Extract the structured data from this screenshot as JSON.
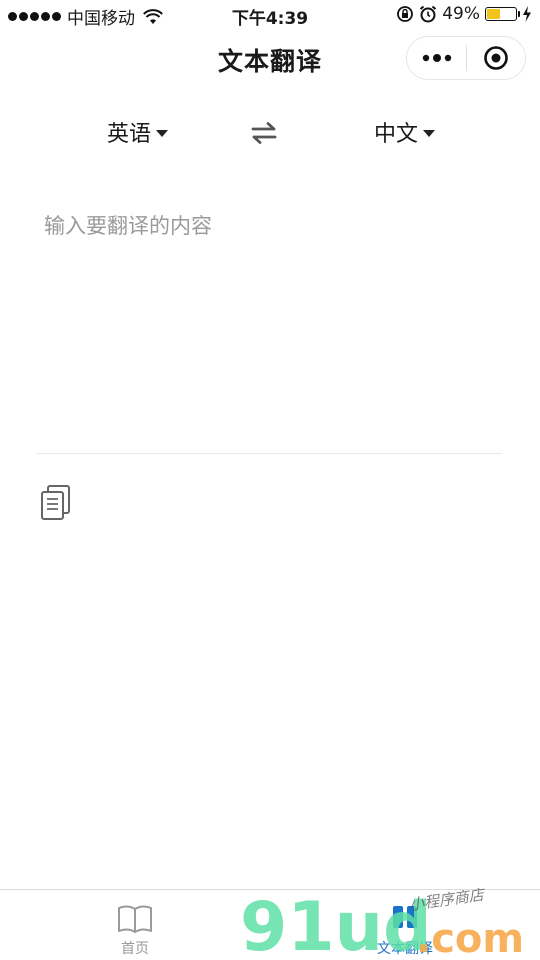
{
  "status_bar": {
    "carrier": "中国移动",
    "time": "下午4:39",
    "battery_percent": "49%",
    "battery_level": 0.49,
    "icons": [
      "signal-dots",
      "wifi-icon",
      "rotation-lock-icon",
      "alarm-icon",
      "battery-icon",
      "charging-icon"
    ]
  },
  "nav": {
    "title": "文本翻译",
    "capsule_icons": [
      "more-icon",
      "close-target-icon"
    ]
  },
  "language_bar": {
    "source_language": "英语",
    "target_language": "中文",
    "swap_icon": "swap-arrows-icon"
  },
  "input": {
    "value": "",
    "placeholder": "输入要翻译的内容"
  },
  "copy_icon": "copy-icon",
  "tab_bar": {
    "items": [
      {
        "label": "首页",
        "icon": "book-icon",
        "active": false
      },
      {
        "label": "文本翻译",
        "icon": "translate-icon",
        "active": true
      }
    ]
  },
  "colors": {
    "active_tab": "#1a73c8",
    "inactive_tab": "#9a9a9a",
    "battery_fill": "#f4c31a",
    "placeholder": "#9a9a9a"
  },
  "watermark": {
    "brand": "91ud",
    "suffix": ".com",
    "tagline": "小程序商店"
  }
}
